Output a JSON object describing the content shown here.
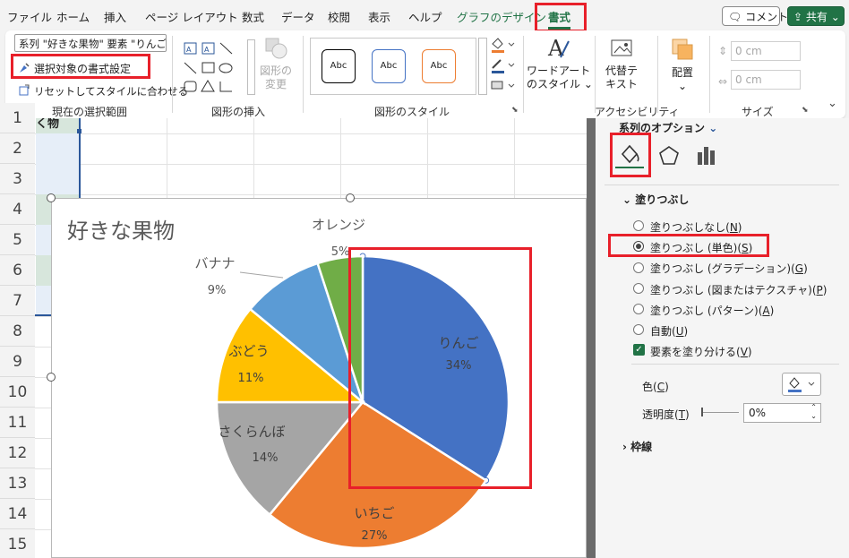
{
  "menu": {
    "items": [
      "ファイル",
      "ホーム",
      "挿入",
      "ページ レイアウト",
      "数式",
      "データ",
      "校閲",
      "表示",
      "ヘルプ",
      "グラフのデザイン",
      "書式"
    ],
    "comment_label": "コメント",
    "share_label": "共有"
  },
  "ribbon": {
    "selection_box": "系列 \"好きな果物\" 要素 \"りんご\"",
    "format_selection": "選択対象の書式設定",
    "reset_style": "リセットしてスタイルに合わせる",
    "group_current_selection": "現在の選択範囲",
    "change_shape": [
      "図形の",
      "変更"
    ],
    "group_insert_shapes": "図形の挿入",
    "style_samples": [
      "Abc",
      "Abc",
      "Abc"
    ],
    "group_shape_styles": "図形のスタイル",
    "wordart_styles": [
      "ワードアート",
      "のスタイル"
    ],
    "alt_text": [
      "代替テ",
      "キスト"
    ],
    "group_accessibility": "アクセシビリティ",
    "arrange": "配置",
    "height_value": "0 cm",
    "width_value": "0 cm",
    "group_size": "サイズ"
  },
  "sheet": {
    "rows": [
      "1",
      "2",
      "3",
      "4",
      "5",
      "6",
      "7",
      "8",
      "9",
      "10",
      "11",
      "12",
      "13",
      "14",
      "15"
    ],
    "cell_a1": "く物"
  },
  "chart_data": {
    "type": "pie",
    "title": "好きな果物",
    "slices": [
      {
        "label": "りんご",
        "percent": 34,
        "color": "#4472c4"
      },
      {
        "label": "いちご",
        "percent": 27,
        "color": "#ed7d31"
      },
      {
        "label": "さくらんぼ",
        "percent": 14,
        "color": "#a5a5a5"
      },
      {
        "label": "ぶどう",
        "percent": 11,
        "color": "#ffc000"
      },
      {
        "label": "バナナ",
        "percent": 9,
        "color": "#5b9bd5"
      },
      {
        "label": "オレンジ",
        "percent": 5,
        "color": "#70ad47"
      }
    ],
    "percent_labels": [
      "34%",
      "27%",
      "14%",
      "11%",
      "9%",
      "5%"
    ]
  },
  "pane": {
    "series_options": "系列のオプション",
    "fill_section": "塗りつぶし",
    "fill_options": [
      {
        "label": "塗りつぶしなし",
        "key": "N"
      },
      {
        "label": "塗りつぶし (単色)",
        "key": "S"
      },
      {
        "label": "塗りつぶし (グラデーション)",
        "key": "G"
      },
      {
        "label": "塗りつぶし (図またはテクスチャ)",
        "key": "P"
      },
      {
        "label": "塗りつぶし (パターン)",
        "key": "A"
      },
      {
        "label": "自動",
        "key": "U"
      }
    ],
    "vary_colors": "要素を塗り分ける",
    "vary_colors_key": "V",
    "color_label": "色",
    "color_key": "C",
    "transparency_label": "透明度",
    "transparency_key": "T",
    "transparency_value": "0%",
    "border_section": "枠線"
  },
  "colors": {
    "accent_green": "#217346",
    "highlight_red": "#e8202a"
  }
}
